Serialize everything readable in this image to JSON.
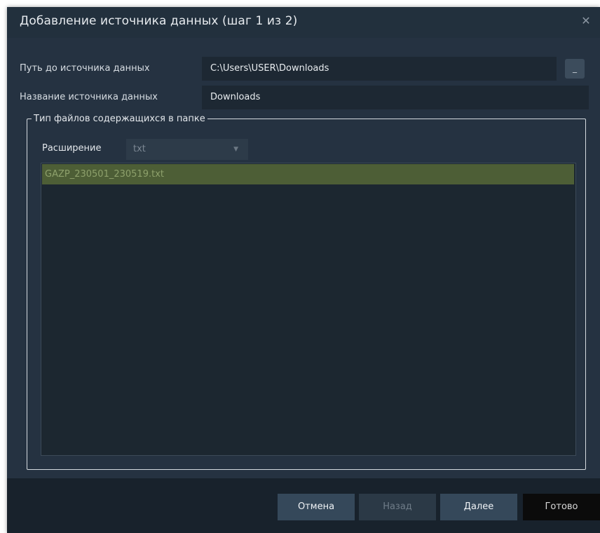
{
  "window": {
    "title": "Добавление источника данных (шаг 1 из 2)",
    "close_glyph": "✕"
  },
  "form": {
    "path_label": "Путь до источника данных",
    "path_value": "C:\\Users\\USER\\Downloads",
    "browse_label": "_",
    "name_label": "Название источника данных",
    "name_value": "Downloads"
  },
  "file_type_group": {
    "legend": "Тип файлов содержащихся в папке",
    "extension_label": "Расширение",
    "extension_selected": "txt",
    "files": [
      "GAZP_230501_230519.txt"
    ]
  },
  "buttons": {
    "cancel": "Отмена",
    "back": "Назад",
    "next": "Далее",
    "done": "Готово"
  },
  "colors": {
    "dialog_bg": "#253241",
    "selected_row": "#4d5e36",
    "footer_bg": "#18222c"
  }
}
